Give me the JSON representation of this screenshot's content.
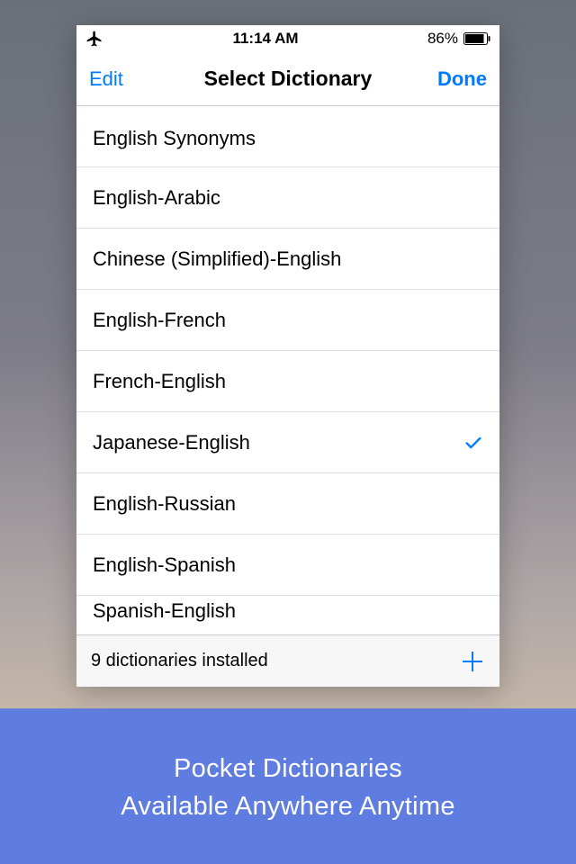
{
  "statusbar": {
    "time": "11:14 AM",
    "battery_pct": "86%"
  },
  "navbar": {
    "left": "Edit",
    "title": "Select Dictionary",
    "right": "Done"
  },
  "dictionaries": [
    {
      "label": "English Synonyms",
      "selected": false
    },
    {
      "label": "English-Arabic",
      "selected": false
    },
    {
      "label": "Chinese (Simplified)-English",
      "selected": false
    },
    {
      "label": "English-French",
      "selected": false
    },
    {
      "label": "French-English",
      "selected": false
    },
    {
      "label": "Japanese-English",
      "selected": true
    },
    {
      "label": "English-Russian",
      "selected": false
    },
    {
      "label": "English-Spanish",
      "selected": false
    },
    {
      "label": "Spanish-English",
      "selected": false
    }
  ],
  "toolbar": {
    "status": "9 dictionaries installed"
  },
  "caption": {
    "line1": "Pocket Dictionaries",
    "line2": "Available Anywhere Anytime"
  },
  "colors": {
    "ios_blue": "#007aff",
    "caption_bg": "#5f7de0"
  }
}
